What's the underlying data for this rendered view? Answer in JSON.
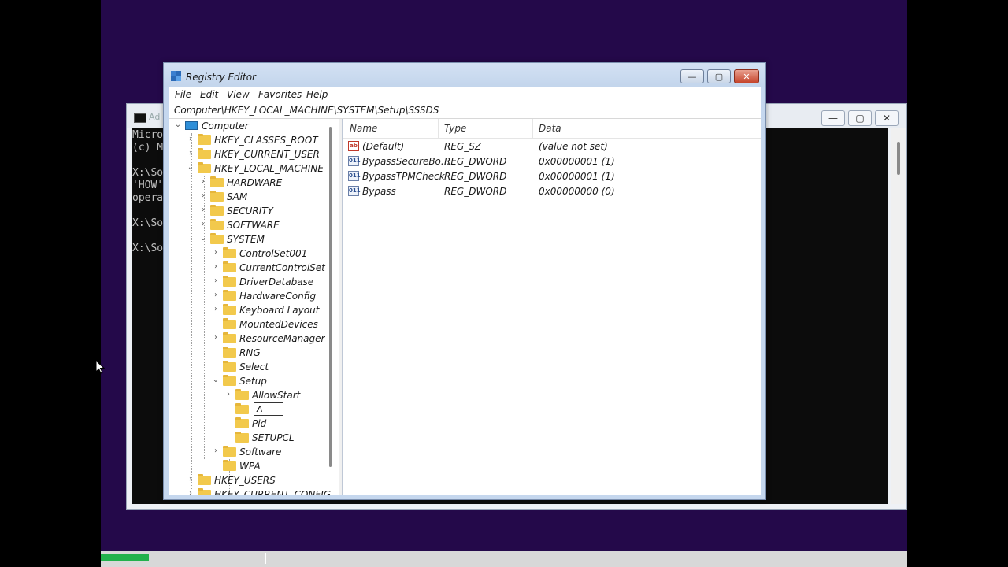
{
  "taskbar": {
    "progress_percent": 6
  },
  "cmd_window": {
    "title": "Ad",
    "lines": [
      "Micro",
      "(c) M",
      "",
      "X:\\So",
      "'HOW'",
      "opera",
      "",
      "X:\\So",
      "",
      "X:\\So"
    ],
    "buttons": {
      "minimize": "—",
      "maximize": "▢",
      "close": "✕"
    }
  },
  "registry": {
    "title": "Registry Editor",
    "buttons": {
      "minimize": "—",
      "maximize": "▢",
      "close": "✕"
    },
    "menu": [
      "File",
      "Edit",
      "View",
      "Favorites",
      "Help"
    ],
    "address": "Computer\\HKEY_LOCAL_MACHINE\\SYSTEM\\Setup\\SSSDS",
    "tree": [
      {
        "label": "Computer",
        "chevron": "⌄",
        "level": 0
      },
      {
        "label": "HKEY_CLASSES_ROOT",
        "chevron": "›",
        "level": 1
      },
      {
        "label": "HKEY_CURRENT_USER",
        "chevron": "›",
        "level": 1
      },
      {
        "label": "HKEY_LOCAL_MACHINE",
        "chevron": "⌄",
        "level": 1
      },
      {
        "label": "HARDWARE",
        "chevron": "›",
        "level": 2
      },
      {
        "label": "SAM",
        "chevron": "›",
        "level": 2
      },
      {
        "label": "SECURITY",
        "chevron": "›",
        "level": 2
      },
      {
        "label": "SOFTWARE",
        "chevron": "›",
        "level": 2
      },
      {
        "label": "SYSTEM",
        "chevron": "⌄",
        "level": 2
      },
      {
        "label": "ControlSet001",
        "chevron": "›",
        "level": 3
      },
      {
        "label": "CurrentControlSet",
        "chevron": "›",
        "level": 3
      },
      {
        "label": "DriverDatabase",
        "chevron": "›",
        "level": 3
      },
      {
        "label": "HardwareConfig",
        "chevron": "›",
        "level": 3
      },
      {
        "label": "Keyboard Layout",
        "chevron": "›",
        "level": 3
      },
      {
        "label": "MountedDevices",
        "chevron": "",
        "level": 3
      },
      {
        "label": "ResourceManager",
        "chevron": "›",
        "level": 3
      },
      {
        "label": "RNG",
        "chevron": "",
        "level": 3
      },
      {
        "label": "Select",
        "chevron": "",
        "level": 3
      },
      {
        "label": "Setup",
        "chevron": "⌄",
        "level": 3
      },
      {
        "label": "AllowStart",
        "chevron": "›",
        "level": 4
      },
      {
        "label": "",
        "chevron": "",
        "level": 4
      },
      {
        "label": "Pid",
        "chevron": "",
        "level": 4
      },
      {
        "label": "SETUPCL",
        "chevron": "",
        "level": 4
      },
      {
        "label": "Software",
        "chevron": "›",
        "level": 3
      },
      {
        "label": "WPA",
        "chevron": "",
        "level": 3
      },
      {
        "label": "HKEY_USERS",
        "chevron": "›",
        "level": 1
      },
      {
        "label": "HKEY_CURRENT_CONFIG",
        "chevron": "›",
        "level": 1
      }
    ],
    "rename_value": "A",
    "columns": [
      "Name",
      "Type",
      "Data"
    ],
    "values": [
      {
        "icon": "ab",
        "name": "(Default)",
        "type": "REG_SZ",
        "data": "(value not set)"
      },
      {
        "icon": "011",
        "name": "BypassSecureBo...",
        "type": "REG_DWORD",
        "data": "0x00000001 (1)"
      },
      {
        "icon": "011",
        "name": "BypassTPMCheck",
        "type": "REG_DWORD",
        "data": "0x00000001 (1)"
      },
      {
        "icon": "011",
        "name": "Bypass",
        "type": "REG_DWORD",
        "data": "0x00000000 (0)"
      }
    ],
    "colors": {
      "folder": "#f2c94c",
      "titlebar": "#c5d7ee",
      "desktop": "#24094a"
    }
  }
}
